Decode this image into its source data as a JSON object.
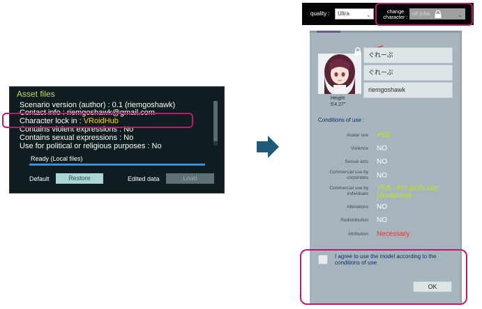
{
  "asset_panel": {
    "title": "Asset files",
    "lines": [
      "Scenario version (author) : 0.1 (riemgoshawk)",
      "Contact info : riemgoshawk@gmail.com",
      "Character lock in :",
      "Contains violent expressions : No",
      "Contains sexual expressions : No",
      "Use for political or religious purposes : No"
    ],
    "lock_value": "VRoidHub",
    "lock_value_color": "#f2d400",
    "status": "Ready (Local files)",
    "progress": 1.0,
    "default_label": "Default",
    "restore_label": "Restore",
    "edited_label": "Edited data",
    "load_label": "Load"
  },
  "top_bar": {
    "quality_label": "quality :",
    "quality_value": "Ultra",
    "change_label_1": "change",
    "change_label_2": "character :",
    "character_value": "off (cha"
  },
  "dialog": {
    "fields": [
      "ぐれーぷ",
      "ぐれーぷ",
      "riemgoshawk"
    ],
    "height_label": "Height",
    "height_value": "5'4.27\"",
    "conditions_title": "Conditions of use :",
    "conditions": [
      {
        "label": "Avatar use",
        "value": "YES",
        "color": "#c8e800"
      },
      {
        "label": "Violence",
        "value": "NO",
        "color": "#ffffff"
      },
      {
        "label": "Sexual acts",
        "value": "NO",
        "color": "#ffffff"
      },
      {
        "label": "Commercial use by corporates",
        "value": "NO",
        "color": "#ffffff"
      },
      {
        "label": "Commercial use by individuals",
        "value": "YES - For-profit use (donations)",
        "color": "#c8e800"
      },
      {
        "label": "Alterations",
        "value": "NO",
        "color": "#ffffff"
      },
      {
        "label": "Redistribution",
        "value": "NO",
        "color": "#ffffff"
      },
      {
        "label": "Attribution",
        "value": "Necessary",
        "color": "#ff2a2a"
      }
    ],
    "agree_text": "I agree to use the model according to the conditions of use",
    "ok_label": "OK"
  },
  "colors": {
    "highlight": "#c0186b",
    "arrow": "#1f5a78",
    "dialog_bg": "#a6b4be"
  }
}
